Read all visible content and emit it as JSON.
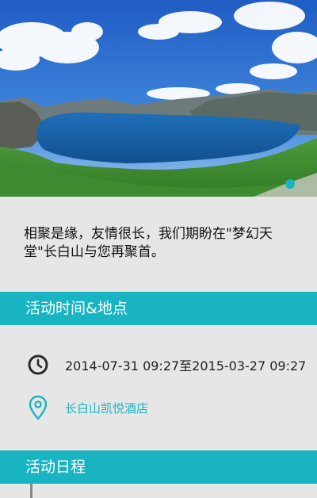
{
  "banner": {
    "image": "lake-mountain-landscape",
    "indicator_color": "#19b4c2"
  },
  "intro": {
    "text": "相聚是缘，友情很长，我们期盼在\"梦幻天堂\"长白山与您再聚首。"
  },
  "sections": {
    "time_place": {
      "title": "活动时间&地点"
    },
    "schedule": {
      "title": "活动日程"
    }
  },
  "event": {
    "time_range": "2014-07-31 09:27至2015-03-27 09:27",
    "location": "长白山凯悦酒店",
    "time_icon": "clock-icon",
    "location_icon": "location-pin-icon"
  },
  "colors": {
    "accent": "#19b4c2",
    "background": "#e6e6e6"
  }
}
